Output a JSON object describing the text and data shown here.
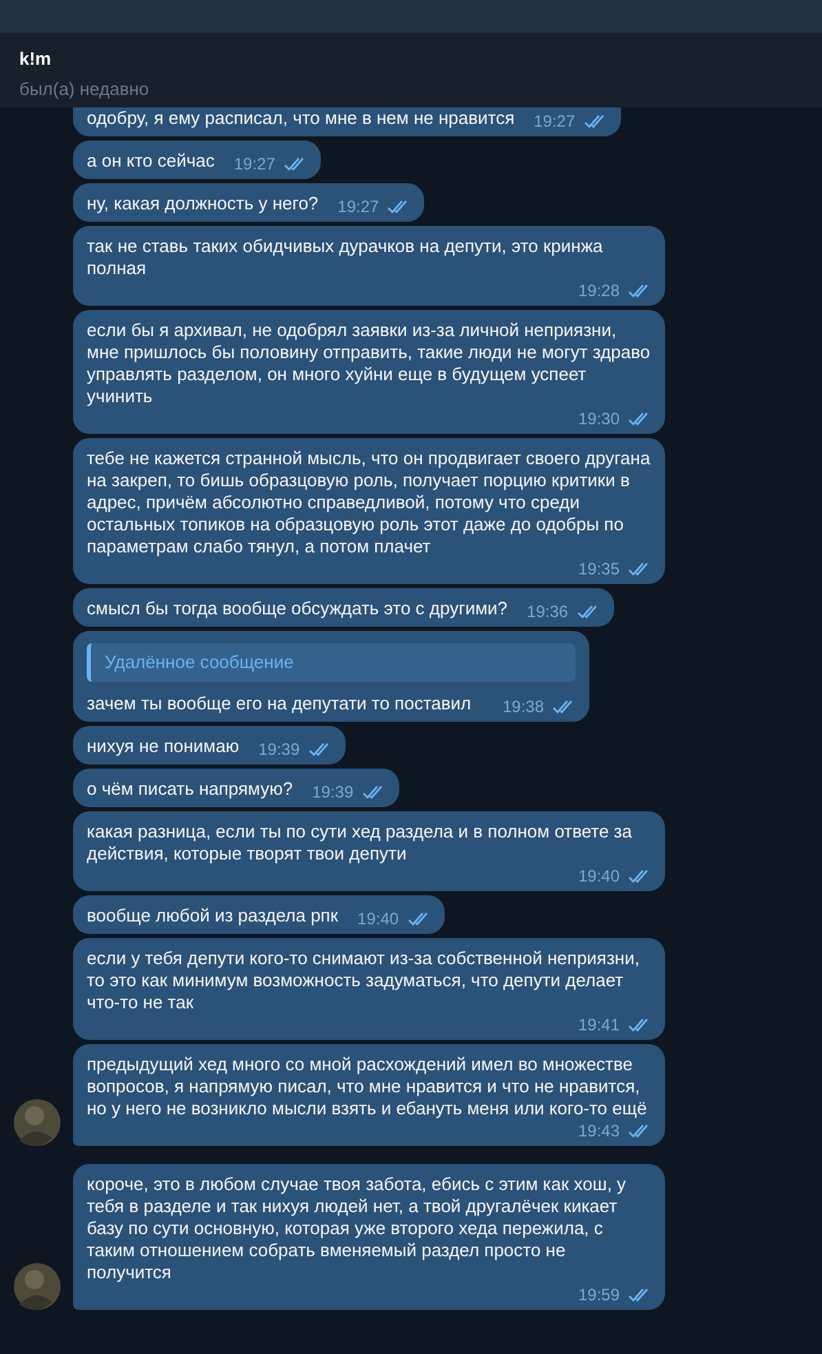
{
  "header": {
    "name": "k!m",
    "status": "был(а) недавно"
  },
  "messages": [
    {
      "text": "одобру, я ему расписал, что мне в нем не нравится",
      "time": "19:27",
      "read": true,
      "avatar": false,
      "new_group": false,
      "cut_top": true
    },
    {
      "text": "а он кто сейчас",
      "time": "19:27",
      "read": true,
      "avatar": false,
      "new_group": false
    },
    {
      "text": "ну, какая должность у него?",
      "time": "19:27",
      "read": true,
      "avatar": false,
      "new_group": false
    },
    {
      "text": "так не ставь таких обидчивых дурачков на депути, это кринжа полная",
      "time": "19:28",
      "read": true,
      "avatar": false,
      "new_group": false
    },
    {
      "text": "если бы я архивал, не одобрял заявки из-за личной неприязни, мне пришлось бы половину отправить, такие люди не могут здраво управлять разделом, он много хуйни еще в будущем успеет учинить",
      "time": "19:30",
      "read": true,
      "avatar": false,
      "new_group": false
    },
    {
      "text": "тебе не кажется странной мысль, что он продвигает своего другана на закреп, то бишь образцовую роль, получает порцию критики в адрес, причём абсолютно справедливой, потому что среди остальных топиков на образцовую роль этот даже до одобры по параметрам слабо тянул, а потом плачет",
      "time": "19:35",
      "read": true,
      "avatar": false,
      "new_group": false
    },
    {
      "text": "смысл бы тогда вообще обсуждать это с другими?",
      "time": "19:36",
      "read": true,
      "avatar": false,
      "new_group": false
    },
    {
      "reply": "Удалённое сообщение",
      "text": "зачем ты вообще его на депутати то поставил",
      "time": "19:38",
      "read": true,
      "avatar": false,
      "new_group": false
    },
    {
      "text": "нихуя не понимаю",
      "time": "19:39",
      "read": true,
      "avatar": false,
      "new_group": false
    },
    {
      "text": "о чём писать напрямую?",
      "time": "19:39",
      "read": true,
      "avatar": false,
      "new_group": false
    },
    {
      "text": "какая разница, если ты по сути хед раздела и в полном ответе за действия, которые творят твои депути",
      "time": "19:40",
      "read": true,
      "avatar": false,
      "new_group": false
    },
    {
      "text": "вообще любой из раздела рпк",
      "time": "19:40",
      "read": true,
      "avatar": false,
      "new_group": false
    },
    {
      "text": "если у тебя депути кого-то снимают из-за собственной неприязни, то это как минимум возможность задуматься, что депути делает что-то не так",
      "time": "19:41",
      "read": true,
      "avatar": false,
      "new_group": false
    },
    {
      "text": "предыдущий хед много со мной расхождений имел во множестве вопросов, я напрямую писал, что мне нравится и что не нравится, но у него не возникло мысли взять и ебануть меня или кого-то ещё",
      "time": "19:43",
      "read": true,
      "avatar": true,
      "new_group": false
    },
    {
      "text": "короче, это в любом случае твоя забота, ебись с этим как хош, у тебя в разделе и так нихуя людей нет, а твой другалёчек кикает базу по сути основную, которая уже второго хеда пережила, с таким отношением собрать вменяемый раздел просто не получится",
      "time": "19:59",
      "read": true,
      "avatar": true,
      "new_group": true
    }
  ]
}
